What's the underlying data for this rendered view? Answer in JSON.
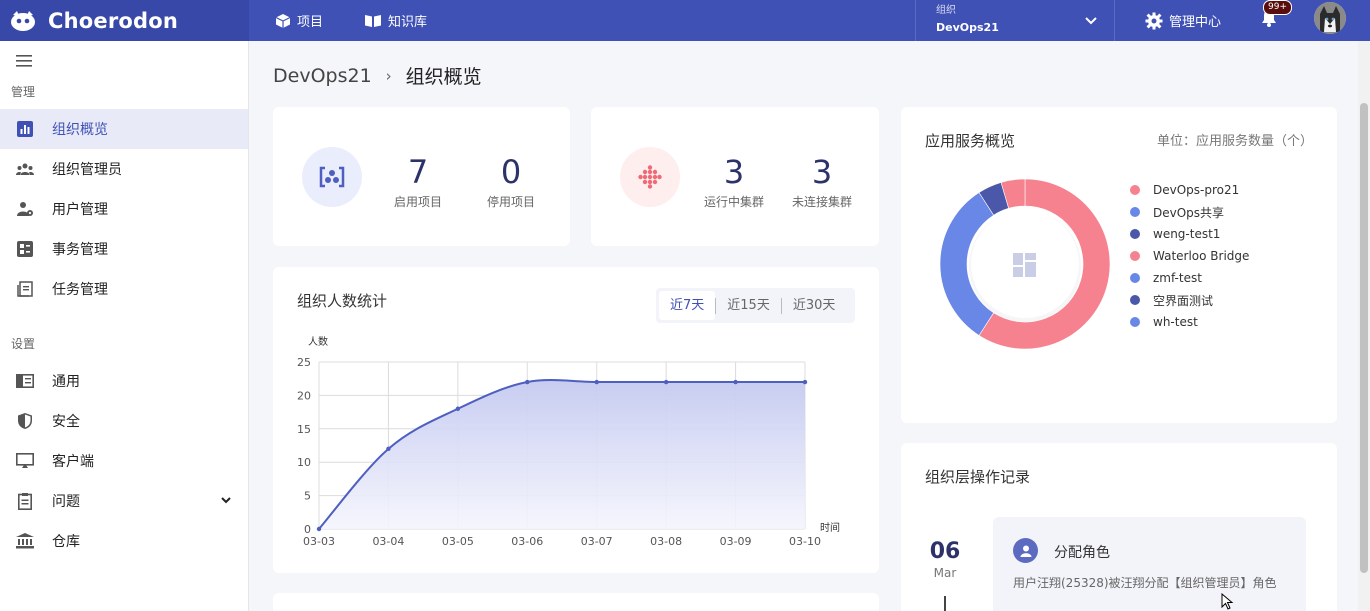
{
  "app": {
    "name": "Choerodon"
  },
  "topnav": {
    "projects": "项目",
    "knowledge": "知识库",
    "admin": "管理中心"
  },
  "org": {
    "label": "组织",
    "value": "DevOps21"
  },
  "notifications": {
    "badge": "99+"
  },
  "sidebar": {
    "manage_title": "管理",
    "settings_title": "设置",
    "manage_items": [
      "组织概览",
      "组织管理员",
      "用户管理",
      "事务管理",
      "任务管理"
    ],
    "settings_items": [
      "通用",
      "安全",
      "客户端",
      "问题",
      "仓库"
    ]
  },
  "breadcrumb": {
    "org": "DevOps21",
    "page": "组织概览"
  },
  "stats": {
    "projects_enabled": {
      "value": "7",
      "label": "启用项目"
    },
    "projects_disabled": {
      "value": "0",
      "label": "停用项目"
    },
    "clusters_running": {
      "value": "3",
      "label": "运行中集群"
    },
    "clusters_disconnected": {
      "value": "3",
      "label": "未连接集群"
    }
  },
  "people_chart": {
    "title": "组织人数统计",
    "ranges": [
      "近7天",
      "近15天",
      "近30天"
    ],
    "selected_range": "近7天"
  },
  "service_overview": {
    "title": "应用服务概览",
    "unit": "单位：应用服务数量（个）"
  },
  "ops_log": {
    "title": "组织层操作记录",
    "day": "06",
    "month": "Mar",
    "entry_title": "分配角色",
    "entry_desc": "用户汪翔(25328)被汪翔分配【组织管理员】角色"
  },
  "chart_data": [
    {
      "type": "area",
      "title": "组织人数统计",
      "xlabel": "时间",
      "ylabel": "人数",
      "x": [
        "03-03",
        "03-04",
        "03-05",
        "03-06",
        "03-07",
        "03-08",
        "03-09",
        "03-10"
      ],
      "values": [
        0,
        12,
        18,
        22,
        22,
        22,
        22,
        22
      ],
      "ylim": [
        0,
        25
      ],
      "yticks": [
        0,
        5,
        10,
        15,
        20,
        25
      ],
      "grid": true,
      "color": "#4e5fc0"
    },
    {
      "type": "pie",
      "title": "应用服务概览",
      "donut": true,
      "labels": [
        "DevOps-pro21",
        "DevOps共享",
        "weng-test1",
        "Waterloo Bridge",
        "zmf-test",
        "空界面测试",
        "wh-test"
      ],
      "values": [
        13,
        7,
        1,
        1,
        0,
        0,
        0
      ],
      "colors": [
        "#f7828f",
        "#6887e6",
        "#4b57a8",
        "#f7828f",
        "#6887e6",
        "#4b57a8",
        "#6887e6"
      ],
      "legend": "right"
    }
  ]
}
